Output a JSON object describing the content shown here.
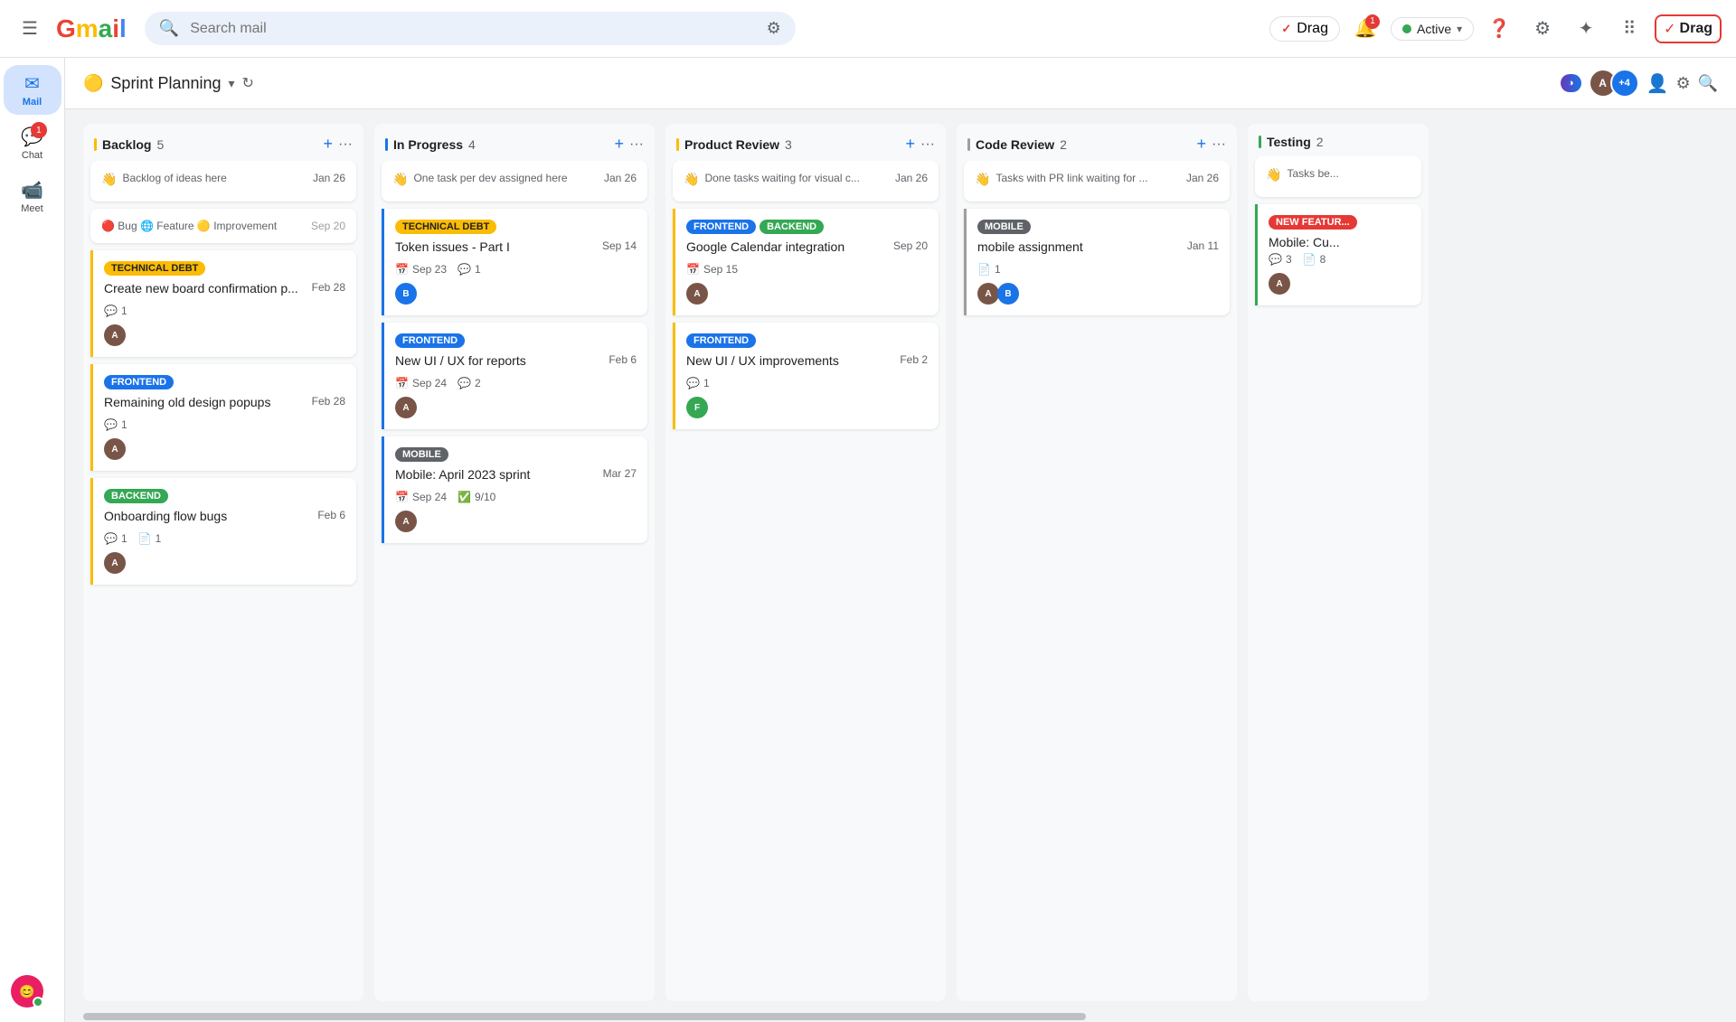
{
  "header": {
    "menu_icon": "☰",
    "gmail_logo_m": "M",
    "gmail_logo_text": "Gmail",
    "search_placeholder": "Search mail",
    "drag_label": "Drag",
    "active_label": "Active",
    "help_icon": "?",
    "settings_icon": "⚙",
    "star_icon": "✦",
    "apps_icon": "⠿",
    "drag_logo_text": "Drag",
    "notification_count": "1"
  },
  "board": {
    "title_emoji": "🟡",
    "title": "Sprint Planning",
    "members": [
      "+4"
    ]
  },
  "sidebar": {
    "items": [
      {
        "id": "mail",
        "icon": "✉",
        "label": "Mail",
        "active": true,
        "badge": null
      },
      {
        "id": "chat",
        "icon": "💬",
        "label": "Chat",
        "active": false,
        "badge": "1"
      },
      {
        "id": "meet",
        "icon": "📹",
        "label": "Meet",
        "active": false,
        "badge": null
      }
    ]
  },
  "columns": [
    {
      "id": "backlog",
      "title": "Backlog",
      "count": "5",
      "border_color": "#fbbc04",
      "cards": [
        {
          "id": "backlog-note",
          "type": "note",
          "emoji": "👋",
          "text": "Backlog of ideas here",
          "date": "Jan 26"
        },
        {
          "id": "backlog-types",
          "type": "types",
          "text": "🔴 Bug 🌐 Feature 🟡 Improvement",
          "date": "Sep 20"
        },
        {
          "id": "backlog-1",
          "type": "card",
          "tags": [
            {
              "label": "TECHNICAL DEBT",
              "class": "tag-technical-debt"
            }
          ],
          "title": "Create new board confirmation p...",
          "date": "Feb 28",
          "comments": "1",
          "files": null,
          "avatar_color": "#795548",
          "avatar_letter": "A",
          "border_class": "col-backlog-border"
        },
        {
          "id": "backlog-2",
          "type": "card",
          "tags": [
            {
              "label": "FRONTEND",
              "class": "tag-frontend"
            }
          ],
          "title": "Remaining old design popups",
          "date": "Feb 28",
          "comments": "1",
          "files": null,
          "avatar_color": "#795548",
          "avatar_letter": "A",
          "border_class": "col-backlog-border"
        },
        {
          "id": "backlog-3",
          "type": "card",
          "tags": [
            {
              "label": "BACKEND",
              "class": "tag-backend"
            }
          ],
          "title": "Onboarding flow bugs",
          "date": "Feb 6",
          "comments": "1",
          "files": "1",
          "avatar_color": "#795548",
          "avatar_letter": "A",
          "border_class": "col-backlog-border"
        }
      ]
    },
    {
      "id": "inprogress",
      "title": "In Progress",
      "count": "4",
      "border_color": "#1a73e8",
      "cards": [
        {
          "id": "inprogress-note",
          "type": "note",
          "emoji": "👋",
          "text": "One task per dev assigned here",
          "date": "Jan 26"
        },
        {
          "id": "inprogress-1",
          "type": "card",
          "tags": [
            {
              "label": "TECHNICAL DEBT",
              "class": "tag-technical-debt"
            }
          ],
          "title": "Token issues - Part I",
          "date": "Sep 14",
          "meta_date": "Sep 23",
          "comments": "1",
          "avatar_color": "#1a73e8",
          "avatar_letter": "B",
          "border_class": "col-inprogress-border"
        },
        {
          "id": "inprogress-2",
          "type": "card",
          "tags": [
            {
              "label": "FRONTEND",
              "class": "tag-frontend"
            }
          ],
          "title": "New UI / UX for reports",
          "date": "Feb 6",
          "meta_date": "Sep 24",
          "comments": "2",
          "avatar_color": "#795548",
          "avatar_letter": "A",
          "border_class": "col-inprogress-border"
        },
        {
          "id": "inprogress-3",
          "type": "card",
          "tags": [
            {
              "label": "MOBILE",
              "class": "tag-mobile"
            }
          ],
          "title": "Mobile: April 2023 sprint",
          "date": "Mar 27",
          "meta_date": "Sep 24",
          "checklist": "9/10",
          "avatar_color": "#795548",
          "avatar_letter": "A",
          "border_class": "col-inprogress-border"
        }
      ]
    },
    {
      "id": "product",
      "title": "Product Review",
      "count": "3",
      "border_color": "#fbbc04",
      "cards": [
        {
          "id": "product-note",
          "type": "note",
          "emoji": "👋",
          "text": "Done tasks waiting for visual c...",
          "date": "Jan 26"
        },
        {
          "id": "product-1",
          "type": "card",
          "tags": [
            {
              "label": "FRONTEND",
              "class": "tag-frontend"
            },
            {
              "label": "BACKEND",
              "class": "tag-backend"
            }
          ],
          "title": "Google Calendar integration",
          "date": "Sep 20",
          "meta_date": "Sep 15",
          "comments": null,
          "avatar_color": "#795548",
          "avatar_letter": "A",
          "border_class": "col-product-border"
        },
        {
          "id": "product-2",
          "type": "card",
          "tags": [
            {
              "label": "FRONTEND",
              "class": "tag-frontend"
            }
          ],
          "title": "New UI / UX improvements",
          "date": "Feb 2",
          "comments": "1",
          "avatar_color": "#34a853",
          "avatar_letter": "F",
          "border_class": "col-product-border"
        }
      ]
    },
    {
      "id": "code",
      "title": "Code Review",
      "count": "2",
      "border_color": "#9e9e9e",
      "cards": [
        {
          "id": "code-note",
          "type": "note",
          "emoji": "👋",
          "text": "Tasks with PR link waiting for ...",
          "date": "Jan 26"
        },
        {
          "id": "code-1",
          "type": "card",
          "tags": [
            {
              "label": "MOBILE",
              "class": "tag-mobile"
            }
          ],
          "title": "mobile assignment",
          "date": "Jan 11",
          "files": "1",
          "avatars": [
            {
              "color": "#795548",
              "letter": "A"
            },
            {
              "color": "#1a73e8",
              "letter": "B"
            }
          ],
          "border_class": "col-code-border"
        }
      ]
    },
    {
      "id": "testing",
      "title": "Testing",
      "count": "2",
      "border_color": "#34a853",
      "cards": [
        {
          "id": "testing-note",
          "type": "note",
          "emoji": "👋",
          "text": "Tasks be...",
          "date": ""
        }
      ]
    }
  ]
}
